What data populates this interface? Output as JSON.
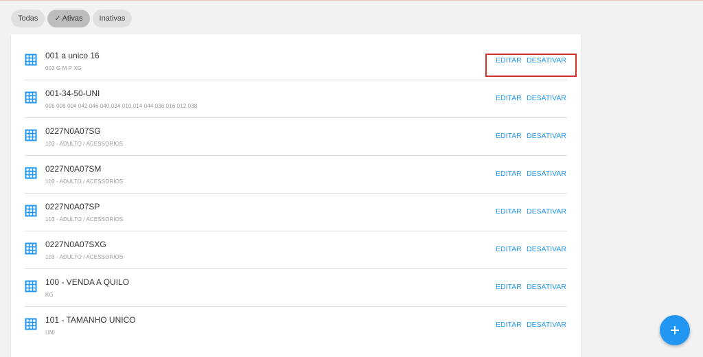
{
  "filters": {
    "todas": "Todas",
    "ativas": "Ativas",
    "inativas": "Inativas",
    "selected": "Ativas"
  },
  "actions": {
    "edit": "EDITAR",
    "deactivate": "DESATIVAR"
  },
  "icons": {
    "row": "grid-table-icon",
    "fab": "plus-icon",
    "chip_check": "check-icon"
  },
  "colors": {
    "accent": "#2196f3",
    "highlight": "#d32f2f"
  },
  "rows": [
    {
      "title": "001 a unico 16",
      "subtitle": "003 G M P XG"
    },
    {
      "title": "001-34-50-UNI",
      "subtitle": "006 008 004 042 046 040 034 010 014 044 036 016 012 038"
    },
    {
      "title": "0227N0A07SG",
      "subtitle": "103 - ADULTO / ACESSORIOS"
    },
    {
      "title": "0227N0A07SM",
      "subtitle": "103 - ADULTO / ACESSORIOS"
    },
    {
      "title": "0227N0A07SP",
      "subtitle": "103 - ADULTO / ACESSORIOS"
    },
    {
      "title": "0227N0A07SXG",
      "subtitle": "103 - ADULTO / ACESSORIOS"
    },
    {
      "title": "100 - VENDA A QUILO",
      "subtitle": "KG"
    },
    {
      "title": "101 - TAMANHO UNICO",
      "subtitle": "UNI"
    }
  ]
}
